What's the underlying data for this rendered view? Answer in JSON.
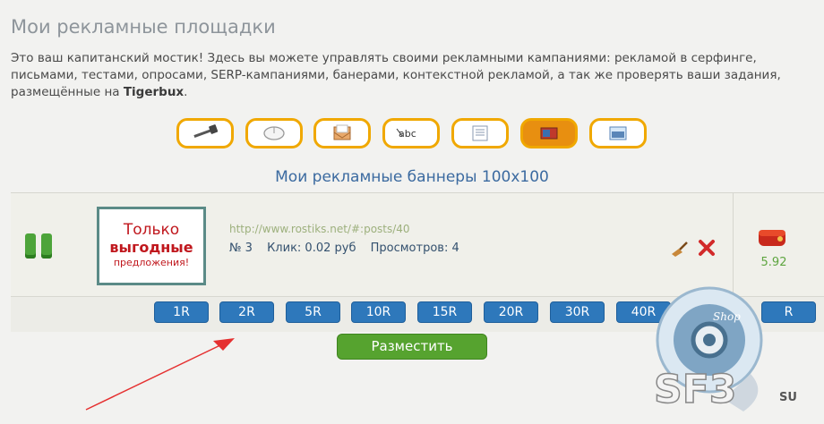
{
  "page": {
    "title": "Мои рекламные площадки",
    "intro_before": "Это ваш капитанский мостик! Здесь вы можете управлять своими рекламными кампаниями: рекламой в серфинге, письмами, тестами, опросами, SERP-кампаниями, банерами, контекстной рекламой, а так же проверять ваши задания, размещённые на ",
    "intro_brand": "Tigerbux",
    "intro_after": "."
  },
  "ad_types": [
    {
      "icon": "hammer-icon",
      "active": false
    },
    {
      "icon": "mouse-icon",
      "active": false
    },
    {
      "icon": "envelope-icon",
      "active": false
    },
    {
      "icon": "text-test-icon",
      "active": false
    },
    {
      "icon": "document-icon",
      "active": false
    },
    {
      "icon": "banner-icon",
      "active": true
    },
    {
      "icon": "image-icon",
      "active": false
    }
  ],
  "section": {
    "title": "Мои рекламные баннеры 100x100"
  },
  "campaign": {
    "banner": {
      "line1": "Только",
      "line2": "выгодные",
      "line3": "предложения!"
    },
    "url": "http://www.rostiks.net/#:posts/40",
    "number": "№ 3",
    "click": "Клик: 0.02 руб",
    "views": "Просмотров: 4",
    "balance": "5.92"
  },
  "amounts": [
    "1R",
    "2R",
    "5R",
    "10R",
    "15R",
    "20R",
    "30R",
    "40R",
    "R"
  ],
  "actions": {
    "place": "Разместить"
  },
  "watermark": {
    "brand": "SF3",
    "tld": "SU",
    "shop": "Shop"
  },
  "colors": {
    "accent_orange": "#f0a800",
    "button_blue": "#2e78bb",
    "button_green": "#56a32f",
    "title_blue": "#3b6aa0"
  }
}
